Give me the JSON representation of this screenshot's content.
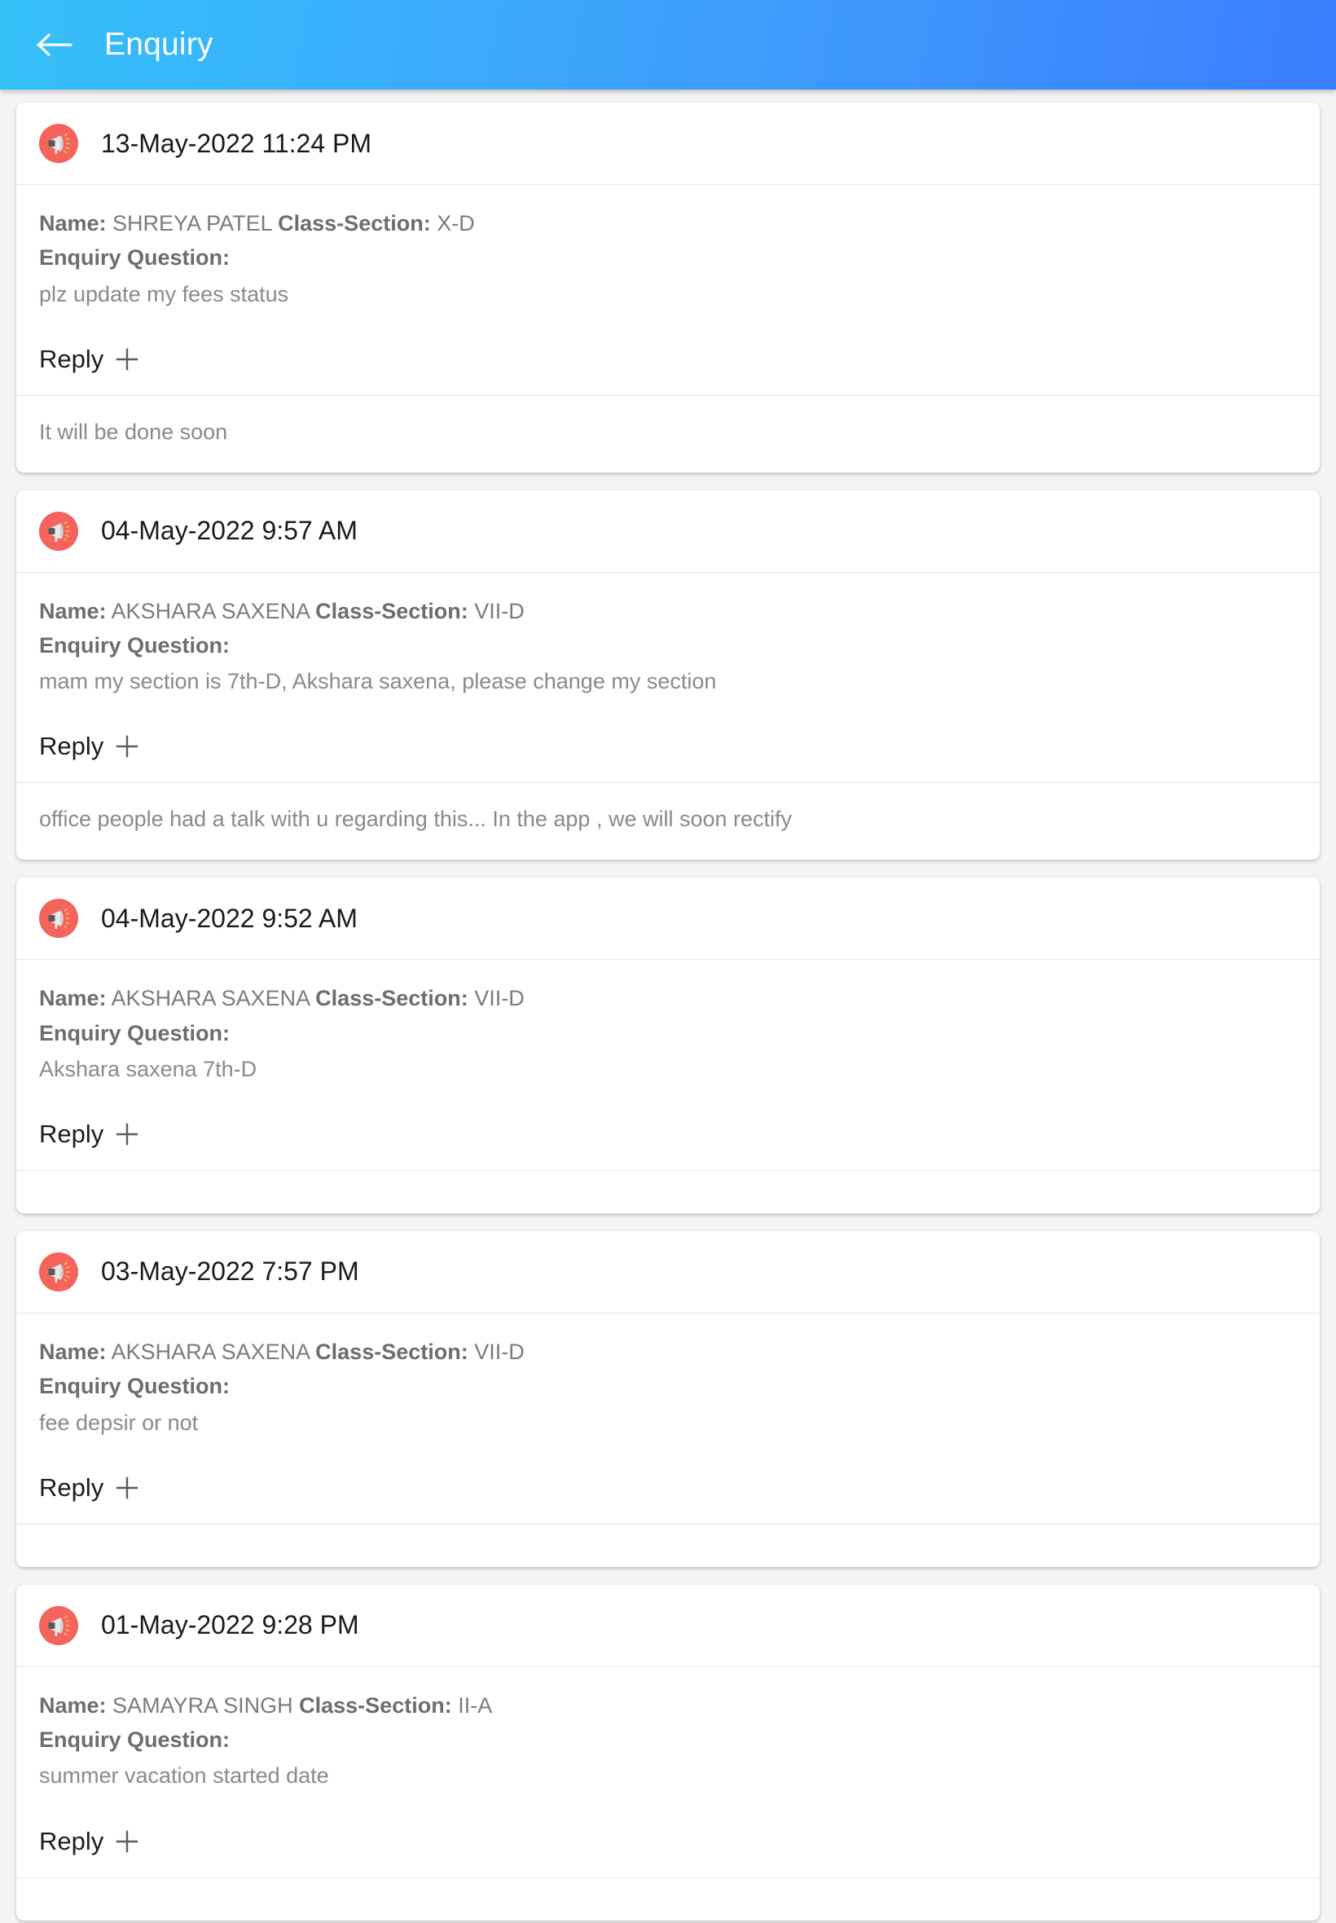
{
  "appbar": {
    "title": "Enquiry",
    "back_icon": "arrow-left-icon",
    "background_start": "#35c0f7",
    "background_end": "#3a7ffc",
    "title_color": "#ffffff"
  },
  "labels": {
    "name_label": "Name:",
    "class_section_label": "Class-Section:",
    "question_label": "Enquiry Question:",
    "reply_label": "Reply",
    "add_icon": "plus-icon",
    "announcement_icon": "megaphone-icon"
  },
  "theme": {
    "icon_circle_color": "#f4645c",
    "card_background": "#ffffff",
    "page_background": "#f4f4f4",
    "divider_color": "#e6e6e6",
    "muted_text": "#8a8a8a",
    "label_text": "#6d6d6d"
  },
  "enquiries": [
    {
      "date": "13-May-2022 11:24 PM",
      "name": "SHREYA PATEL",
      "class_section": "X-D",
      "question": "plz update my fees status",
      "reply": "It will be done soon"
    },
    {
      "date": "04-May-2022 9:57 AM",
      "name": "AKSHARA SAXENA",
      "class_section": "VII-D",
      "question": "mam my section is 7th-D, Akshara saxena, please change my section",
      "reply": "office people had a talk with u regarding this... In the app , we will soon rectify"
    },
    {
      "date": "04-May-2022 9:52 AM",
      "name": "AKSHARA SAXENA",
      "class_section": "VII-D",
      "question": "Akshara saxena 7th-D",
      "reply": ""
    },
    {
      "date": "03-May-2022 7:57 PM",
      "name": "AKSHARA SAXENA",
      "class_section": "VII-D",
      "question": "fee depsir or not",
      "reply": ""
    },
    {
      "date": "01-May-2022 9:28 PM",
      "name": "SAMAYRA SINGH",
      "class_section": "II-A",
      "question": "summer vacation started date",
      "reply": ""
    }
  ]
}
